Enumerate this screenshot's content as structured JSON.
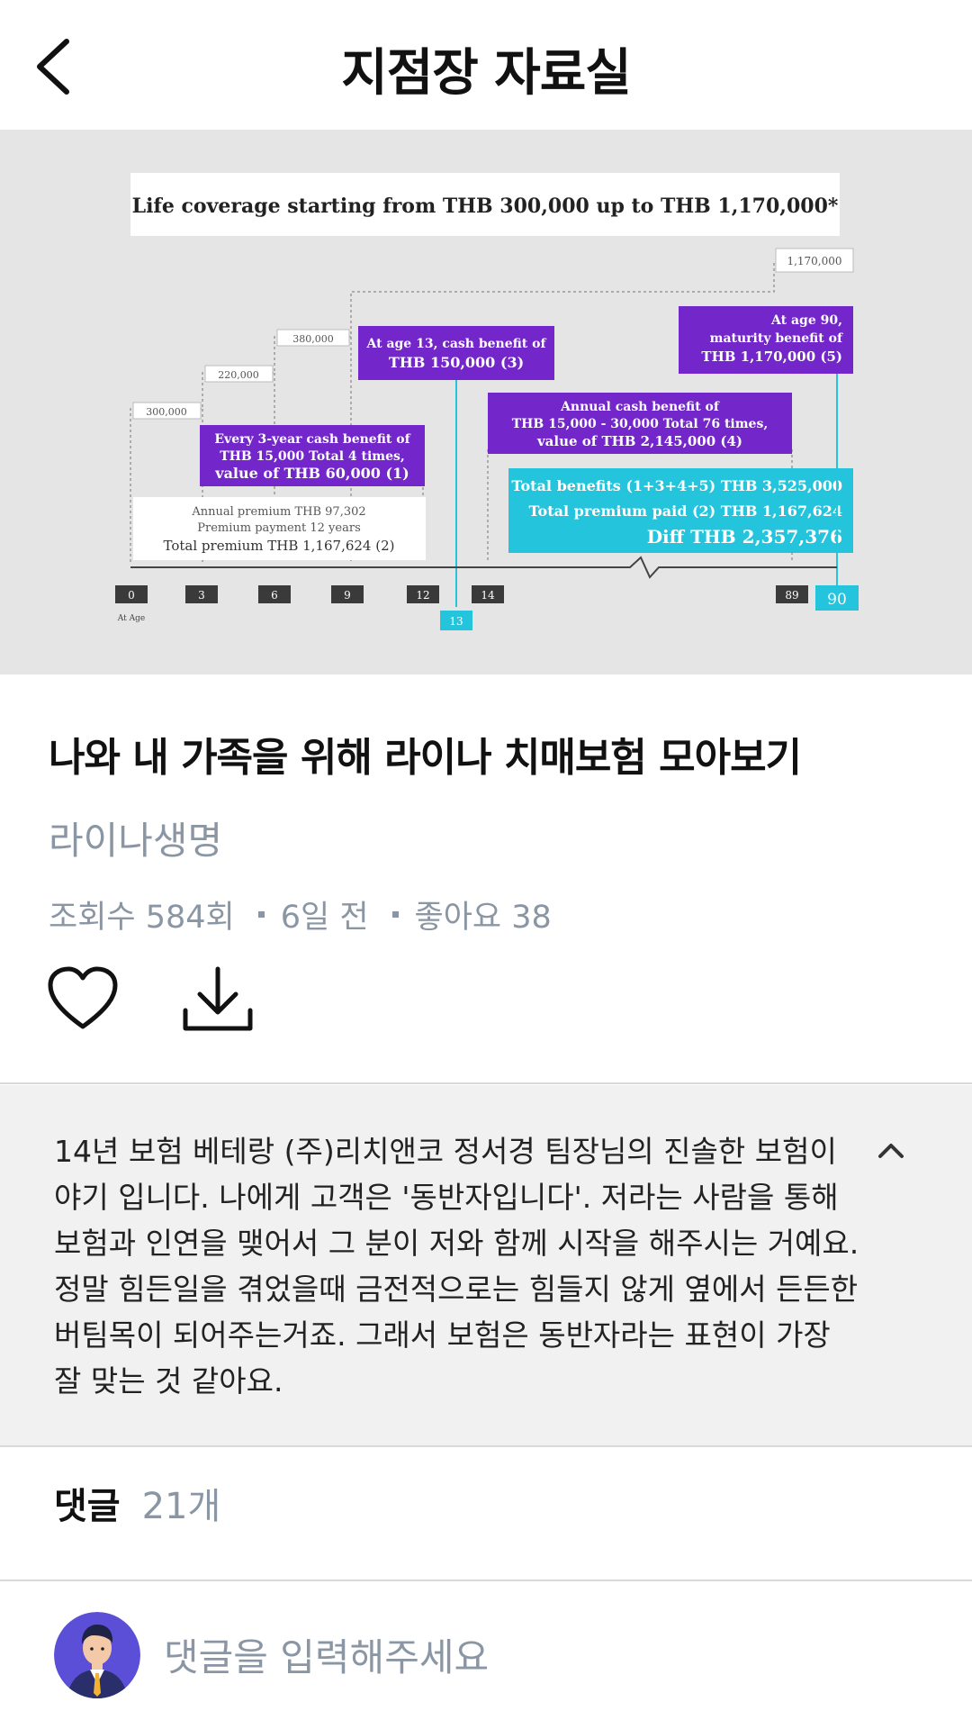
{
  "header": {
    "title": "지점장 자료실"
  },
  "infographic": {
    "headline": "Life coverage starting from THB 300,000 up to THB 1,170,000*",
    "coverage_steps": [
      "300,000",
      "220,000",
      "380,000",
      "1,170,000"
    ],
    "box_every3": [
      "Every 3-year cash benefit of",
      "THB 15,000  Total 4 times,",
      "value of THB 60,000 (1)"
    ],
    "box_age13": [
      "At age 13, cash benefit of",
      "THB 150,000 (3)"
    ],
    "box_annual": [
      "Annual cash benefit of",
      "THB 15,000 - 30,000  Total 76 times,",
      "value of THB 2,145,000 (4)"
    ],
    "box_age90": [
      "At age 90,",
      "maturity benefit of",
      "THB 1,170,000 (5)"
    ],
    "premium_box": [
      "Annual premium THB 97,302",
      "Premium payment 12 years",
      "Total premium THB 1,167,624 (2)"
    ],
    "totals_box": [
      "Total benefits (1+3+4+5) THB 3,525,000",
      "Total premium paid (2) THB 1,167,624",
      "Diff THB 2,357,376"
    ],
    "ages": [
      "0",
      "3",
      "6",
      "9",
      "12",
      "14",
      "89",
      "90"
    ],
    "age13": "13",
    "age_axis_label": "At Age",
    "colors": {
      "purple": "#7326c9",
      "cyan": "#24c4dd",
      "dark": "#3a3a3a"
    }
  },
  "post": {
    "title": "나와 내 가족을 위해 라이나 치매보험 모아보기",
    "author": "라이나생명",
    "views": "조회수 584회",
    "date": "6일 전",
    "likes": "좋아요 38"
  },
  "icons": {
    "like": "heart-icon",
    "download": "download-icon",
    "back": "chevron-left-icon",
    "collapse": "chevron-up-icon"
  },
  "description": "14년 보험 베테랑 (주)리치앤코 정서경 팀장님의 진솔한 보험이야기 입니다. 나에게 고객은 '동반자입니다'. 저라는 사람을 통해 보험과 인연을 맺어서 그 분이 저와 함께 시작을 해주시는 거예요. 정말 힘든일을 겪었을때 금전적으로는 힘들지 않게 옆에서 든든한 버팀목이 되어주는거죠. 그래서 보험은 동반자라는 표현이 가장 잘 맞는 것 같아요.",
  "comments": {
    "label": "댓글",
    "count": "21개",
    "placeholder": "댓글을 입력해주세요"
  }
}
